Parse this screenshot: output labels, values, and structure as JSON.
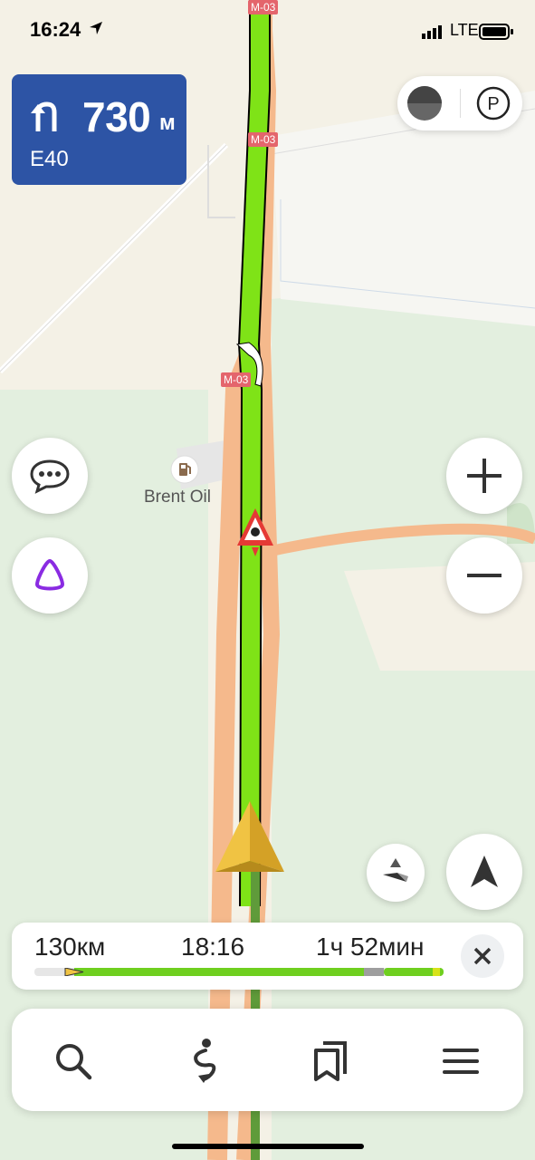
{
  "status_bar": {
    "time": "16:24",
    "network": "LTE"
  },
  "maneuver": {
    "distance": "730",
    "unit": "м",
    "road": "E40"
  },
  "map": {
    "road_shields": [
      "M-03",
      "M-03",
      "M-03"
    ],
    "poi": {
      "name": "Brent Oil",
      "icon": "fuel-station-icon"
    }
  },
  "route": {
    "distance": "130км",
    "eta": "18:16",
    "duration": "1ч 52мин",
    "progress": 0.1
  },
  "colors": {
    "route": "#7fe317",
    "road": "#f5b98c",
    "maneuver_card": "#2d54a5",
    "alice": "#8a2be2"
  },
  "bottom_bar": {
    "tabs": [
      "search-icon",
      "route-icon",
      "bookmarks-icon",
      "menu-icon"
    ]
  }
}
